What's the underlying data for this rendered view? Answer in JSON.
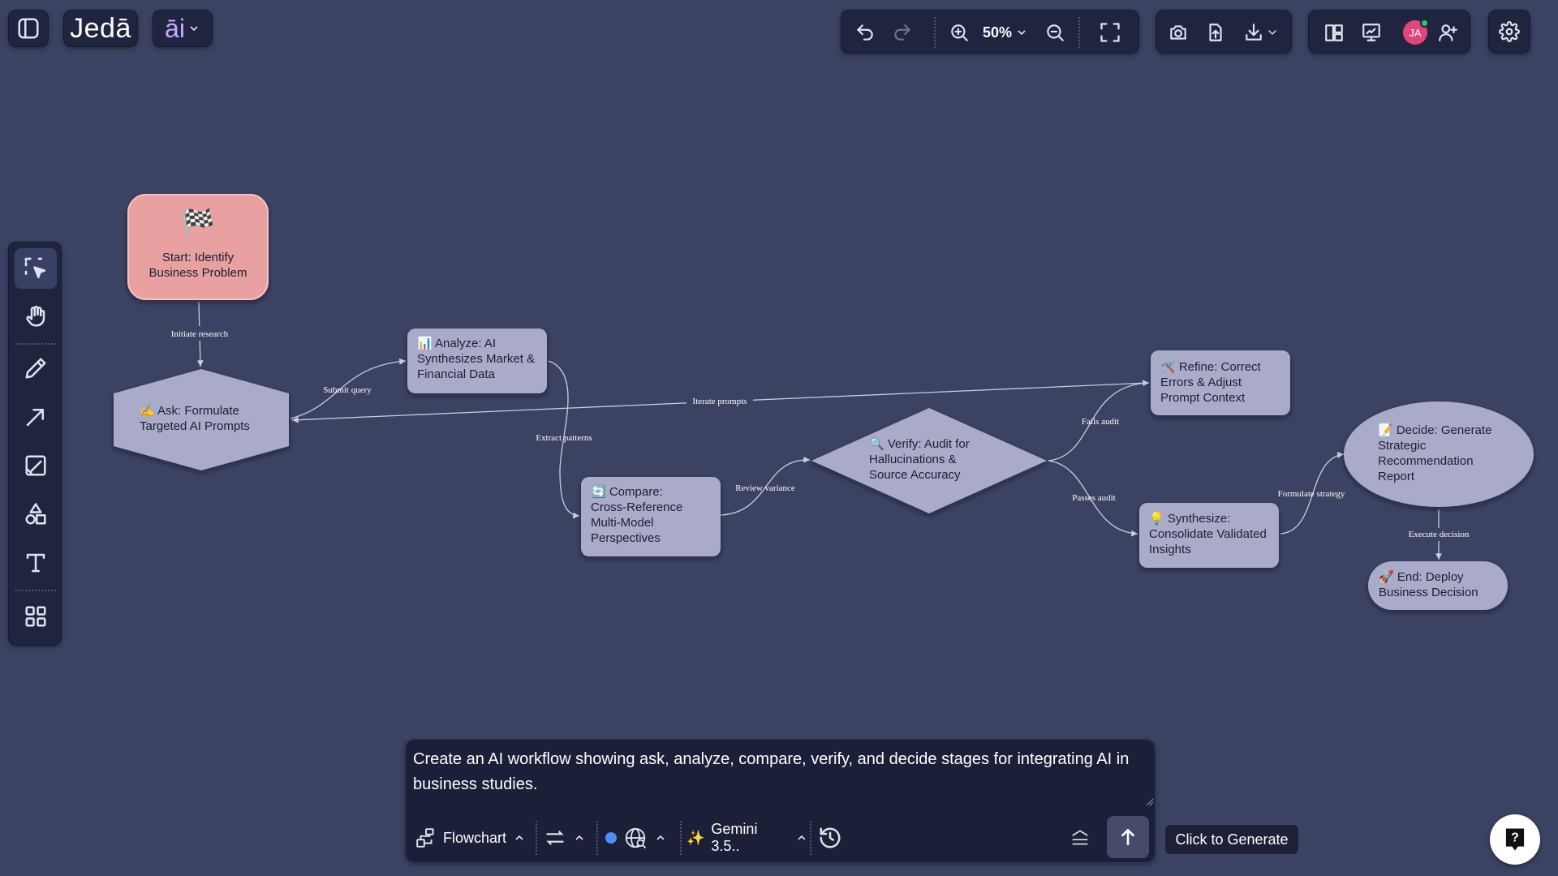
{
  "header": {
    "logo_text": "Jedā",
    "ai_menu_label": "āi",
    "zoom_level": "50%"
  },
  "canvas": {
    "nodes": {
      "start": {
        "icon": "🏁",
        "line1": "Start: Identify",
        "line2": "Business Problem"
      },
      "ask": {
        "line1": "✍️ Ask: Formulate",
        "line2": "Targeted AI Prompts"
      },
      "analyze": {
        "line1": "📊 Analyze: AI",
        "line2": "Synthesizes Market &",
        "line3": "Financial Data"
      },
      "compare": {
        "line1": "🔄 Compare:",
        "line2": "Cross-Reference",
        "line3": "Multi-Model",
        "line4": "Perspectives"
      },
      "verify": {
        "line1": "🔍 Verify: Audit for",
        "line2": "Hallucinations &",
        "line3": "Source Accuracy"
      },
      "refine": {
        "line1": "🛠️ Refine: Correct",
        "line2": "Errors & Adjust",
        "line3": "Prompt Context"
      },
      "synthesize": {
        "line1": "💡 Synthesize:",
        "line2": "Consolidate Validated",
        "line3": "Insights"
      },
      "decide": {
        "line1": "📝 Decide: Generate",
        "line2": "Strategic",
        "line3": "Recommendation",
        "line4": "Report"
      },
      "end": {
        "line1": "🚀 End: Deploy",
        "line2": "Business Decision"
      }
    },
    "edges": {
      "initiate_research": "Initiate research",
      "submit_query": "Submit query",
      "iterate_prompts": "Iterate prompts",
      "extract_patterns": "Extract patterns",
      "review_variance": "Review variance",
      "fails_audit": "Fails audit",
      "passes_audit": "Passes audit",
      "formulate_strategy": "Formulate strategy",
      "execute_decision": "Execute decision"
    }
  },
  "prompt": {
    "text": "Create an AI workflow showing ask, analyze, compare, verify, and decide stages for integrating AI in business studies.",
    "diagram_type": "Flowchart",
    "model_name": "Gemini 3.5..",
    "generate_tooltip": "Click to Generate"
  },
  "avatar": {
    "initials": "JA"
  },
  "colors": {
    "background": "#3b4262",
    "panel": "#20253f",
    "start_node": "#e8a0a0",
    "node_fill": "#a9abc9",
    "accent_blue": "#4d8ff5",
    "avatar_bg": "#e0457b",
    "online_dot": "#2ec46b"
  }
}
